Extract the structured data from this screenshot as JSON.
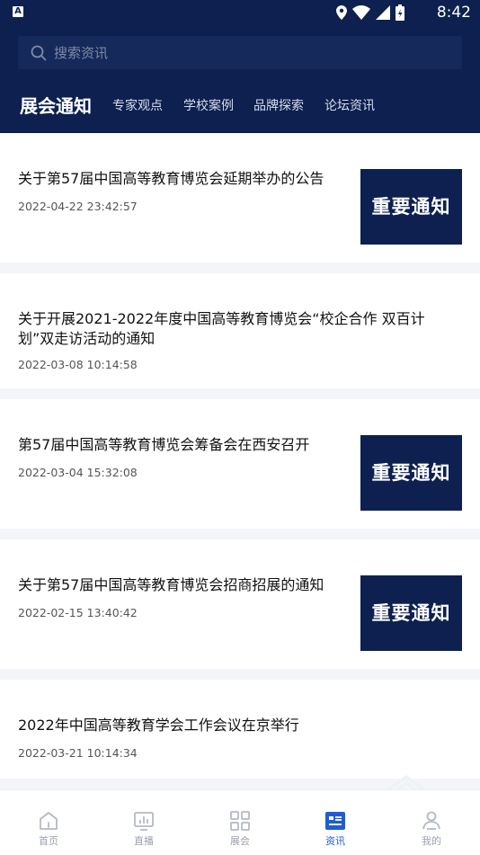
{
  "status_bar": {
    "app_icon": "A",
    "time": "8:42"
  },
  "search": {
    "placeholder": "搜索资讯"
  },
  "tabs": [
    {
      "label": "展会通知",
      "active": true
    },
    {
      "label": "专家观点",
      "active": false
    },
    {
      "label": "学校案例",
      "active": false
    },
    {
      "label": "品牌探索",
      "active": false
    },
    {
      "label": "论坛资讯",
      "active": false
    }
  ],
  "articles": [
    {
      "title": "关于第57届中国高等教育博览会延期举办的公告",
      "date": "2022-04-22 23:42:57",
      "thumb": "重要通知"
    },
    {
      "title_line1": "关于开展2021-2022年度中国高等教育博览会“校企合作 双百计",
      "title_line2": "划”双走访活动的通知",
      "date": "2022-03-08 10:14:58"
    },
    {
      "title": "第57届中国高等教育博览会筹备会在西安召开",
      "date": "2022-03-04 15:32:08",
      "thumb": "重要通知"
    },
    {
      "title": "关于第57届中国高等教育博览会招商招展的通知",
      "date": "2022-02-15 13:40:42",
      "thumb": "重要通知"
    },
    {
      "title": "2022年中国高等教育学会工作会议在京举行",
      "date": "2022-03-21 10:14:34"
    }
  ],
  "bottom_nav": [
    {
      "label": "首页",
      "icon": "home-icon",
      "active": false
    },
    {
      "label": "直播",
      "icon": "live-icon",
      "active": false
    },
    {
      "label": "展会",
      "icon": "grid-icon",
      "active": false
    },
    {
      "label": "资讯",
      "icon": "news-icon",
      "active": true
    },
    {
      "label": "我的",
      "icon": "user-icon",
      "active": false
    }
  ],
  "colors": {
    "header_bg": "#0d2050",
    "accent": "#1f5cd6",
    "nav_inactive": "#9aa0ad"
  }
}
